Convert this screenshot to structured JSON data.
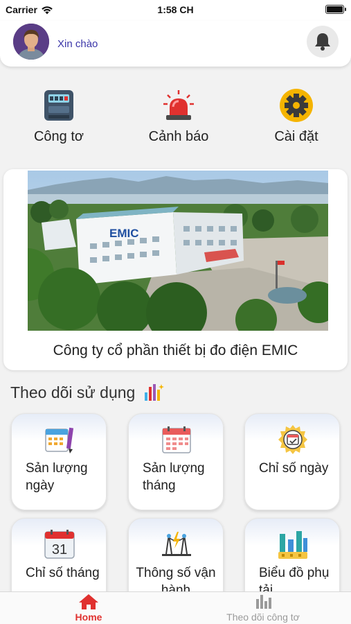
{
  "status_bar": {
    "carrier": "Carrier",
    "time": "1:58 CH"
  },
  "header": {
    "greeting": "Xin chào"
  },
  "quick_actions": [
    {
      "label": "Công tơ",
      "icon": "electric-meter-icon"
    },
    {
      "label": "Cảnh báo",
      "icon": "siren-alarm-icon"
    },
    {
      "label": "Cài đặt",
      "icon": "gear-icon"
    }
  ],
  "company": {
    "name": "Công ty cổ phần thiết bị đo điện EMIC",
    "photo_sign": "EMIC"
  },
  "usage": {
    "title": "Theo dõi sử dụng",
    "tiles": [
      {
        "label": "Sản lượng ngày",
        "icon": "daily-calendar-pencil-icon"
      },
      {
        "label": "Sản lượng tháng",
        "icon": "monthly-calendar-icon"
      },
      {
        "label": "Chỉ số ngày",
        "icon": "daily-index-badge-icon"
      },
      {
        "label": "Chỉ số tháng",
        "icon": "calendar-31-icon",
        "day": "31"
      },
      {
        "label": "Thông số vận hành",
        "icon": "power-tower-icon"
      },
      {
        "label": "Biểu đồ phụ tải",
        "icon": "load-chart-icon"
      }
    ]
  },
  "tabbar": {
    "tabs": [
      {
        "label": "Home",
        "icon": "home-icon",
        "active": true
      },
      {
        "label": "Theo dõi công tơ",
        "icon": "bar-chart-icon",
        "active": false
      }
    ]
  },
  "colors": {
    "accent_red": "#e0312f",
    "greeting_blue": "#3a35a8",
    "tab_inactive": "#9a9a9a"
  }
}
